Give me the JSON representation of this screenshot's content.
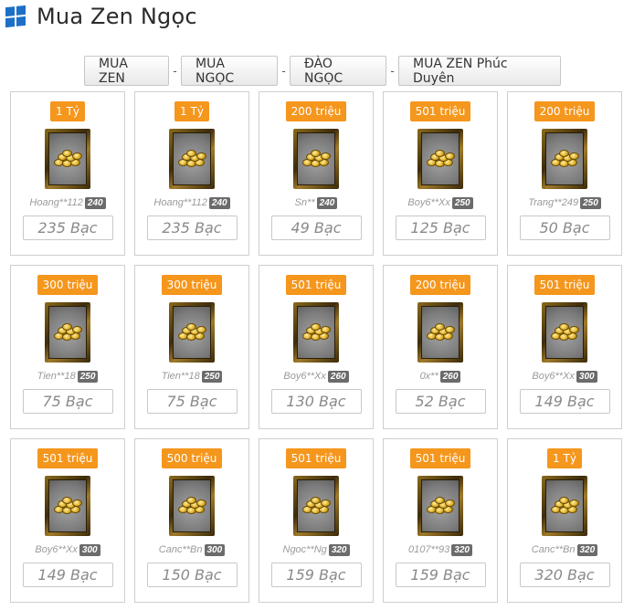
{
  "header": {
    "title": "Mua Zen Ngọc",
    "icon": "windows-icon",
    "icon_color": "#1e6fc6"
  },
  "tabs": [
    {
      "label": "MUA ZEN"
    },
    {
      "label": "MUA NGỌC"
    },
    {
      "label": "ĐÀO NGỌC"
    },
    {
      "label": "MUA ZEN Phúc Duyên"
    }
  ],
  "tab_separator": "-",
  "accent_color": "#f5961d",
  "items": [
    {
      "amount": "1 Tỷ",
      "seller": "Hoang**112",
      "level": "240",
      "price": "235 Bạc"
    },
    {
      "amount": "1 Tỷ",
      "seller": "Hoang**112",
      "level": "240",
      "price": "235 Bạc"
    },
    {
      "amount": "200 triệu",
      "seller": "Sn**",
      "level": "240",
      "price": "49 Bạc"
    },
    {
      "amount": "501 triệu",
      "seller": "Boy6**Xx",
      "level": "250",
      "price": "125 Bạc"
    },
    {
      "amount": "200 triệu",
      "seller": "Trang**249",
      "level": "250",
      "price": "50 Bạc"
    },
    {
      "amount": "300 triệu",
      "seller": "Tien**18",
      "level": "250",
      "price": "75 Bạc"
    },
    {
      "amount": "300 triệu",
      "seller": "Tien**18",
      "level": "250",
      "price": "75 Bạc"
    },
    {
      "amount": "501 triệu",
      "seller": "Boy6**Xx",
      "level": "260",
      "price": "130 Bạc"
    },
    {
      "amount": "200 triệu",
      "seller": "0x**",
      "level": "260",
      "price": "52 Bạc"
    },
    {
      "amount": "501 triệu",
      "seller": "Boy6**Xx",
      "level": "300",
      "price": "149 Bạc"
    },
    {
      "amount": "501 triệu",
      "seller": "Boy6**Xx",
      "level": "300",
      "price": "149 Bạc"
    },
    {
      "amount": "500 triệu",
      "seller": "Canc**Bn",
      "level": "300",
      "price": "150 Bạc"
    },
    {
      "amount": "501 triệu",
      "seller": "Ngoc**Ng",
      "level": "320",
      "price": "159 Bạc"
    },
    {
      "amount": "501 triệu",
      "seller": "0107**93",
      "level": "320",
      "price": "159 Bạc"
    },
    {
      "amount": "1 Tỷ",
      "seller": "Canc**Bn",
      "level": "320",
      "price": "320 Bạc"
    }
  ]
}
